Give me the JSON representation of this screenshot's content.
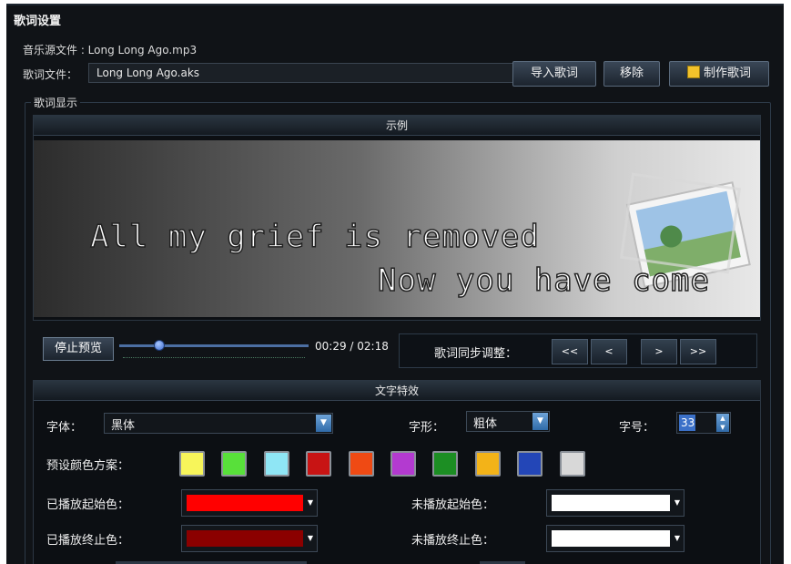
{
  "window": {
    "title": "歌词设置"
  },
  "music_file": {
    "label": "音乐源文件 : Long Long Ago.mp3"
  },
  "lyric_file": {
    "label": "歌词文件：",
    "value": "Long Long Ago.aks"
  },
  "buttons": {
    "import": "导入歌词",
    "remove": "移除",
    "make": "制作歌词"
  },
  "lyric_display": {
    "legend": "歌词显示",
    "example_header": "示例",
    "line1": "All my grief is removed",
    "line2": "Now you have come"
  },
  "playback": {
    "stop_preview": "停止预览",
    "time": "00:29 / 02:18",
    "progress_fraction": 0.21
  },
  "sync": {
    "label": "歌词同步调整：",
    "buttons": [
      "<<",
      "<",
      ">",
      ">>"
    ]
  },
  "text_effects": {
    "header": "文字特效",
    "font_label": "字体：",
    "font_value": "黑体",
    "style_label": "字形：",
    "style_value": "粗体",
    "size_label": "字号：",
    "size_value": "33",
    "preset_label": "预设颜色方案：",
    "presets": [
      "#f7f55a",
      "#58e03a",
      "#8fe6f5",
      "#c81414",
      "#ef4a14",
      "#b33ad0",
      "#1c8e23",
      "#f3b318",
      "#2346b7",
      "#d8d8d8"
    ],
    "played_start_label": "已播放起始色：",
    "played_start_color": "#ff0000",
    "played_end_label": "已播放终止色：",
    "played_end_color": "#8b0000",
    "unplayed_start_label": "未播放起始色：",
    "unplayed_start_color": "#ffffff",
    "unplayed_end_label": "未播放终止色：",
    "unplayed_end_color": "#ffffff"
  }
}
